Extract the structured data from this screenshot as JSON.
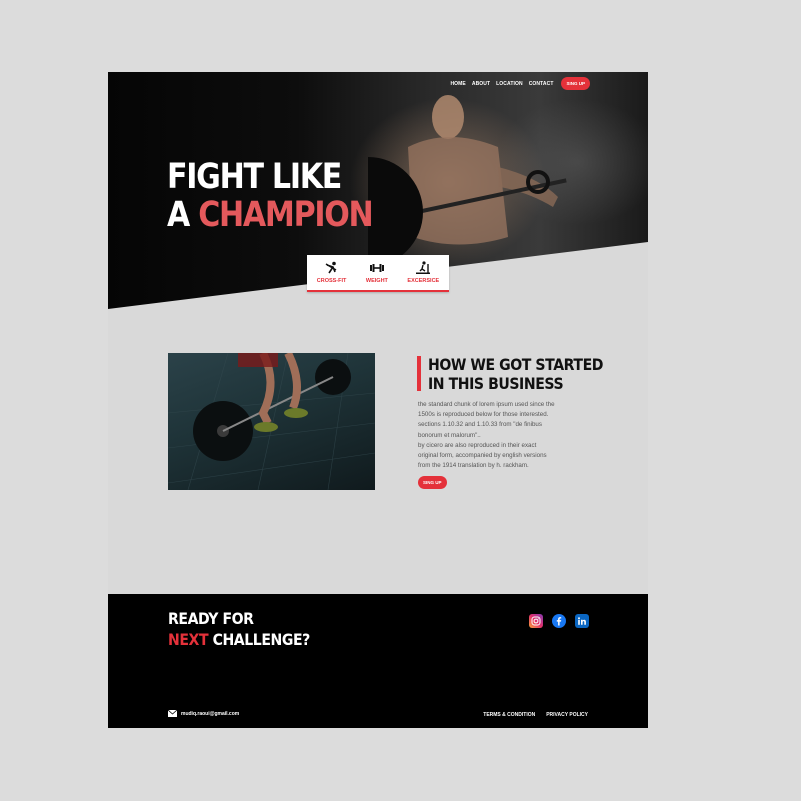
{
  "nav": {
    "links": [
      "HOME",
      "ABOUT",
      "LOCATION",
      "CONTACT"
    ],
    "cta": "SING UP"
  },
  "hero": {
    "title_line1": "FIGHT LIKE",
    "title_line2_prefix": "A ",
    "title_line2_accent": "CHAMPION"
  },
  "categories": [
    {
      "label": "CROSS-FIT",
      "icon": "crossfit-icon"
    },
    {
      "label": "WEIGHT",
      "icon": "dumbbell-icon"
    },
    {
      "label": "EXCERSICE",
      "icon": "treadmill-icon"
    }
  ],
  "story": {
    "heading_line1": "HOW WE GOT STARTED",
    "heading_line2": "IN THIS BUSINESS",
    "body_lines": [
      "the standard chunk of lorem ipsum used since the",
      "1500s is reproduced below for those interested.",
      "sections 1.10.32 and 1.10.33 from \"de finibus",
      "bonorum et malorum\"..",
      "by cicero are also reproduced in their exact",
      "original form, accompanied by english versions",
      "from the 1914 translation by h. rackham."
    ],
    "cta": "SING UP"
  },
  "footer": {
    "title_line1": "READY FOR",
    "title_line2_accent": "NEXT",
    "title_line2_rest": " CHALLENGE?",
    "socials": [
      "instagram-icon",
      "facebook-icon",
      "linkedin-icon"
    ],
    "email": "mudiq.raoui@gmail.com",
    "links": [
      "TERMS & CONDITION",
      "PRIVACY POLICY"
    ]
  },
  "colors": {
    "accent": "#e4313a",
    "hero_accent_text": "#e4595c",
    "dark": "#000000",
    "page_bg": "#d9d9d9"
  }
}
